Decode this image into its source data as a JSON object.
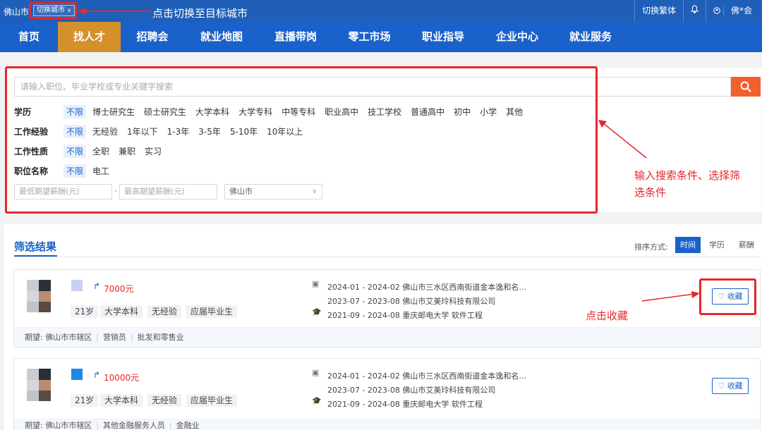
{
  "topbar": {
    "city": "佛山市",
    "switch_city": "切换城市",
    "traditional": "切换繁体",
    "user": "佛*会"
  },
  "annotations": {
    "switch_city_hint": "点击切换至目标城市",
    "search_hint_line1": "输入搜索条件、选择筛",
    "search_hint_line2": "选条件",
    "favorite_hint": "点击收藏"
  },
  "nav": {
    "items": [
      "首页",
      "找人才",
      "招聘会",
      "就业地图",
      "直播带岗",
      "零工市场",
      "职业指导",
      "企业中心",
      "就业服务"
    ],
    "active_index": 1
  },
  "search": {
    "placeholder": "请输入职位、毕业学校或专业关键字搜索"
  },
  "filters": {
    "education": {
      "label": "学历",
      "options": [
        "不限",
        "博士研究生",
        "硕士研究生",
        "大学本科",
        "大学专科",
        "中等专科",
        "职业高中",
        "技工学校",
        "普通高中",
        "初中",
        "小学",
        "其他"
      ]
    },
    "experience": {
      "label": "工作经验",
      "options": [
        "不限",
        "无经验",
        "1年以下",
        "1-3年",
        "3-5年",
        "5-10年",
        "10年以上"
      ]
    },
    "nature": {
      "label": "工作性质",
      "options": [
        "不限",
        "全职",
        "兼职",
        "实习"
      ]
    },
    "position": {
      "label": "职位名称",
      "options": [
        "不限",
        "电工"
      ]
    },
    "min_salary_placeholder": "最低期望薪酬(元)",
    "max_salary_placeholder": "最高期望薪酬(元)",
    "dash": "-",
    "city_select": "佛山市"
  },
  "results": {
    "title": "筛选结果",
    "sort_label": "排序方式:",
    "sort_options": [
      "时间",
      "学历",
      "薪酬"
    ],
    "sort_active": 0,
    "favorite_label": "收藏",
    "expect_label": "期望:",
    "cards": [
      {
        "salary": "7000元",
        "tags": [
          "21岁",
          "大学本科",
          "无经验",
          "应届毕业生"
        ],
        "experience": [
          "2024-01 - 2024-02  佛山市三水区西南街道金本逸和名...",
          "2023-07 - 2023-08  佛山市艾美玲科技有限公司",
          "2021-09 - 2024-08  重庆邮电大学 软件工程"
        ],
        "expect": [
          "佛山市市辖区",
          "营销员",
          "批发和零售业"
        ],
        "name_color": "#c9d0f2"
      },
      {
        "salary": "10000元",
        "tags": [
          "21岁",
          "大学本科",
          "无经验",
          "应届毕业生"
        ],
        "experience": [
          "2024-01 - 2024-02  佛山市三水区西南街道金本逸和名...",
          "2023-07 - 2023-08  佛山市艾美玲科技有限公司",
          "2021-09 - 2024-08  重庆邮电大学 软件工程"
        ],
        "expect": [
          "佛山市市辖区",
          "其他金融服务人员",
          "金融业"
        ],
        "name_color": "#1e88e5"
      }
    ]
  },
  "colors": {
    "topbar": "#1f5fb8",
    "nav": "#1a62c9",
    "nav_active": "#d4902b",
    "search_button": "#f2602e",
    "salary": "#e8262b",
    "annotation": "#e8262b"
  },
  "icons": [
    "search-icon",
    "bell-icon",
    "user-icon",
    "chevron-down-icon",
    "heart-icon",
    "briefcase-icon",
    "graduation-cap-icon",
    "salary-icon"
  ]
}
